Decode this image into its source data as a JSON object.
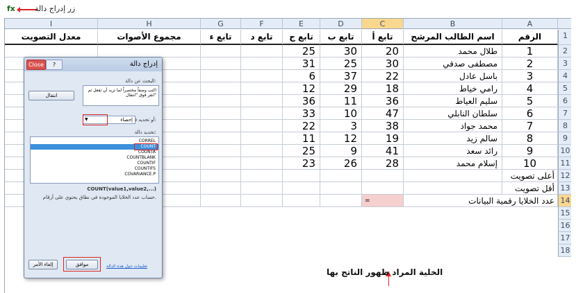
{
  "callout": {
    "text": "زر إدراج دالة",
    "fx": "fx"
  },
  "columns": [
    "A",
    "B",
    "C",
    "D",
    "E",
    "F",
    "G",
    "H",
    "I"
  ],
  "selected_column": "C",
  "rows": [
    "1",
    "2",
    "3",
    "4",
    "5",
    "6",
    "7",
    "8",
    "9",
    "10",
    "11",
    "12",
    "13",
    "14",
    "15",
    "16",
    "17",
    "18"
  ],
  "selected_row": "14",
  "headers": {
    "num": "الرقم",
    "name": "اسم الطالب المرشح",
    "a": "تابع أ",
    "b": "تابع ب",
    "c": "تابع ج",
    "d": "تابع د",
    "e": "تابع ء",
    "total": "مجموع الأصوات",
    "avg": "معدل التصويت"
  },
  "students": [
    {
      "n": "1",
      "name": "طلال محمد",
      "a": "20",
      "b": "30",
      "c": "25"
    },
    {
      "n": "2",
      "name": "مصطفى صدقي",
      "a": "30",
      "b": "25",
      "c": "31"
    },
    {
      "n": "3",
      "name": "باسل عادل",
      "a": "22",
      "b": "37",
      "c": "6"
    },
    {
      "n": "4",
      "name": "رامي خياط",
      "a": "18",
      "b": "29",
      "c": "12"
    },
    {
      "n": "5",
      "name": "سليم العياط",
      "a": "36",
      "b": "11",
      "c": "36"
    },
    {
      "n": "6",
      "name": "سلطان النابلي",
      "a": "47",
      "b": "10",
      "c": "33"
    },
    {
      "n": "7",
      "name": "محمد جواد",
      "a": "38",
      "b": "3",
      "c": "22"
    },
    {
      "n": "8",
      "name": "سالم زيد",
      "a": "19",
      "b": "12",
      "c": "11"
    },
    {
      "n": "9",
      "name": "رائد سعد",
      "a": "41",
      "b": "9",
      "c": "25"
    },
    {
      "n": "10",
      "name": "إسلام محمد",
      "a": "28",
      "b": "26",
      "c": "23"
    }
  ],
  "summary": {
    "max": "أعلى تصويت",
    "min": "أقل تصويت",
    "count": "عدد الخلايا رقمية البيانات"
  },
  "annotation": "الخلية المراد ظهور الناتج بها",
  "dialog": {
    "title": "إدراج دالة",
    "close": "Close",
    "help": "?",
    "search_label": "البحث عن دالة:",
    "search_text": "اكتب وصفاً مختصراً لما تريد أن تفعل ثم انقر فوق \"انتقال\"",
    "go_button": "انتقال",
    "category_label": "أو تحديد فئة:",
    "category_value": "إحصاء",
    "select_label": "تحديد دالة:",
    "functions": [
      "CORREL",
      "COUNT",
      "COUNTA",
      "COUNTBLANK",
      "COUNTIF",
      "COUNTIFS",
      "COVARIANCE.P"
    ],
    "selected_function": "COUNT",
    "syntax": "COUNT(value1,value2,...)",
    "description": "حساب عدد الخلايا الموجودة في نطاق يحتوي على أرقام.",
    "help_link": "تعليمات حول هذه الدالة",
    "ok": "موافق",
    "cancel": "إلغاء الأمر"
  },
  "colors": {
    "selection": "#f9d88e",
    "highlight": "#3d8fdb",
    "callout": "#dd2222"
  }
}
